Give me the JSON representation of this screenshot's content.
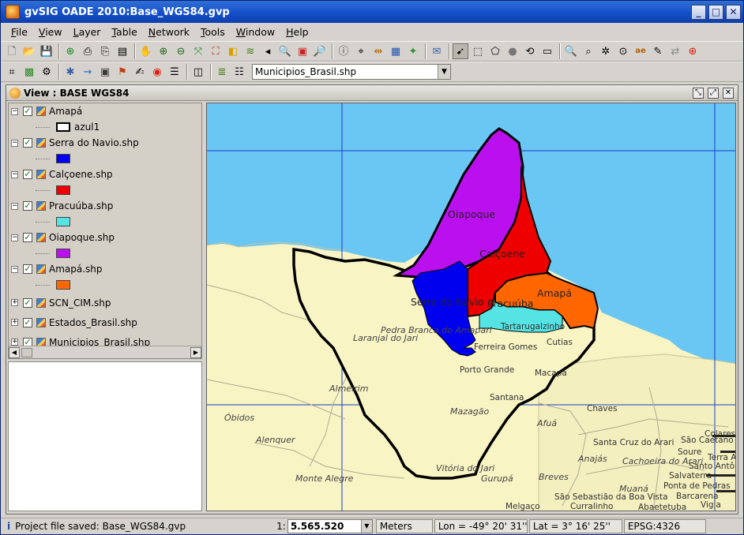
{
  "window": {
    "title": "gvSIG OADE 2010:Base_WGS84.gvp",
    "minimize": "_",
    "maximize": "□",
    "close": "✕"
  },
  "menu": [
    "File",
    "View",
    "Layer",
    "Table",
    "Network",
    "Tools",
    "Window",
    "Help"
  ],
  "layer_combo": {
    "selected": "Municipios_Brasil.shp"
  },
  "view": {
    "title": "View : BASE WGS84"
  },
  "toc": {
    "layers": [
      {
        "name": "Amapá",
        "legend_label": "azul1",
        "legend_color": "#000000",
        "legend_fill": "#ffffff"
      },
      {
        "name": "Serra do Navio.shp",
        "legend_color": "#0000ee"
      },
      {
        "name": "Calçoene.shp",
        "legend_color": "#ee0000"
      },
      {
        "name": "Pracuúba.shp",
        "legend_color": "#55e3e3"
      },
      {
        "name": "Oiapoque.shp",
        "legend_color": "#bb10ee"
      },
      {
        "name": "Amapá.shp",
        "legend_color": "#ff6600"
      },
      {
        "name": "SCN_CIM.shp"
      },
      {
        "name": "Estados_Brasil.shp"
      },
      {
        "name": "Municipios_Brasil.shp"
      }
    ]
  },
  "map": {
    "colors": {
      "ocean": "#6ac7f3",
      "land": "#f8f4c4",
      "grid": "#1a3cc8"
    },
    "region_labels": [
      "Oiapoque",
      "Calçoene",
      "Amapá",
      "Serra do Navio",
      "Pracuúba"
    ],
    "place_labels": [
      "Laranjal do Jari",
      "Pedra Branca do Amapari",
      "Tartarugalzinho",
      "Ferreira Gomes",
      "Cutias",
      "Porto Grande",
      "Macapá",
      "Santana",
      "Almeirim",
      "Mazagão",
      "Óbidos",
      "Afuá",
      "Chaves",
      "Alenquer",
      "Santa Cruz do Arari",
      "Anajás",
      "Cachoeira do Arari",
      "Monte Alegre",
      "Vitória do Jari",
      "Gurupá",
      "Breves",
      "Muaná",
      "São Sebastião da Boa Vista",
      "Curralinho",
      "Melgaço",
      "Soure",
      "Salvaterra",
      "Ponta de Pedras",
      "Barcarena",
      "Abaetetuba",
      "São Caetano de Odivelas",
      "Colares",
      "Santo Antônio do Tauá",
      "Terra Alta",
      "Vigia"
    ]
  },
  "status": {
    "message": "Project file saved: Base_WGS84.gvp",
    "scale_prefix": "1:",
    "scale": "5.565.520",
    "units": "Meters",
    "lon": "Lon = -49° 20' 31''",
    "lat": "Lat = 3° 16' 25''",
    "crs": "EPSG:4326"
  }
}
